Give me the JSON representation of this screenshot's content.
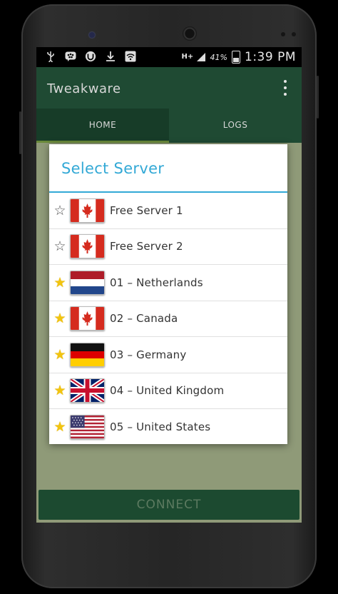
{
  "status_bar": {
    "net_label": "H+",
    "battery_percent": "41%",
    "time": "1:39 PM"
  },
  "app": {
    "title": "Tweakware"
  },
  "tabs": [
    {
      "label": "HOME",
      "active": true
    },
    {
      "label": "LOGS",
      "active": false
    }
  ],
  "connect_label": "CONNECT",
  "dialog": {
    "title": "Select Server",
    "servers": [
      {
        "name": "Free Server 1",
        "favorite": false,
        "flag": "canada"
      },
      {
        "name": "Free Server 2",
        "favorite": false,
        "flag": "canada"
      },
      {
        "name": "01 – Netherlands",
        "favorite": true,
        "flag": "netherlands"
      },
      {
        "name": "02 – Canada",
        "favorite": true,
        "flag": "canada"
      },
      {
        "name": "03 – Germany",
        "favorite": true,
        "flag": "germany"
      },
      {
        "name": "04 – United Kingdom",
        "favorite": true,
        "flag": "united-kingdom"
      },
      {
        "name": "05 – United States",
        "favorite": true,
        "flag": "united-states"
      }
    ]
  },
  "colors": {
    "accent": "#33a9d6",
    "appbar": "#1f4a33",
    "star_filled": "#f2c40f"
  }
}
